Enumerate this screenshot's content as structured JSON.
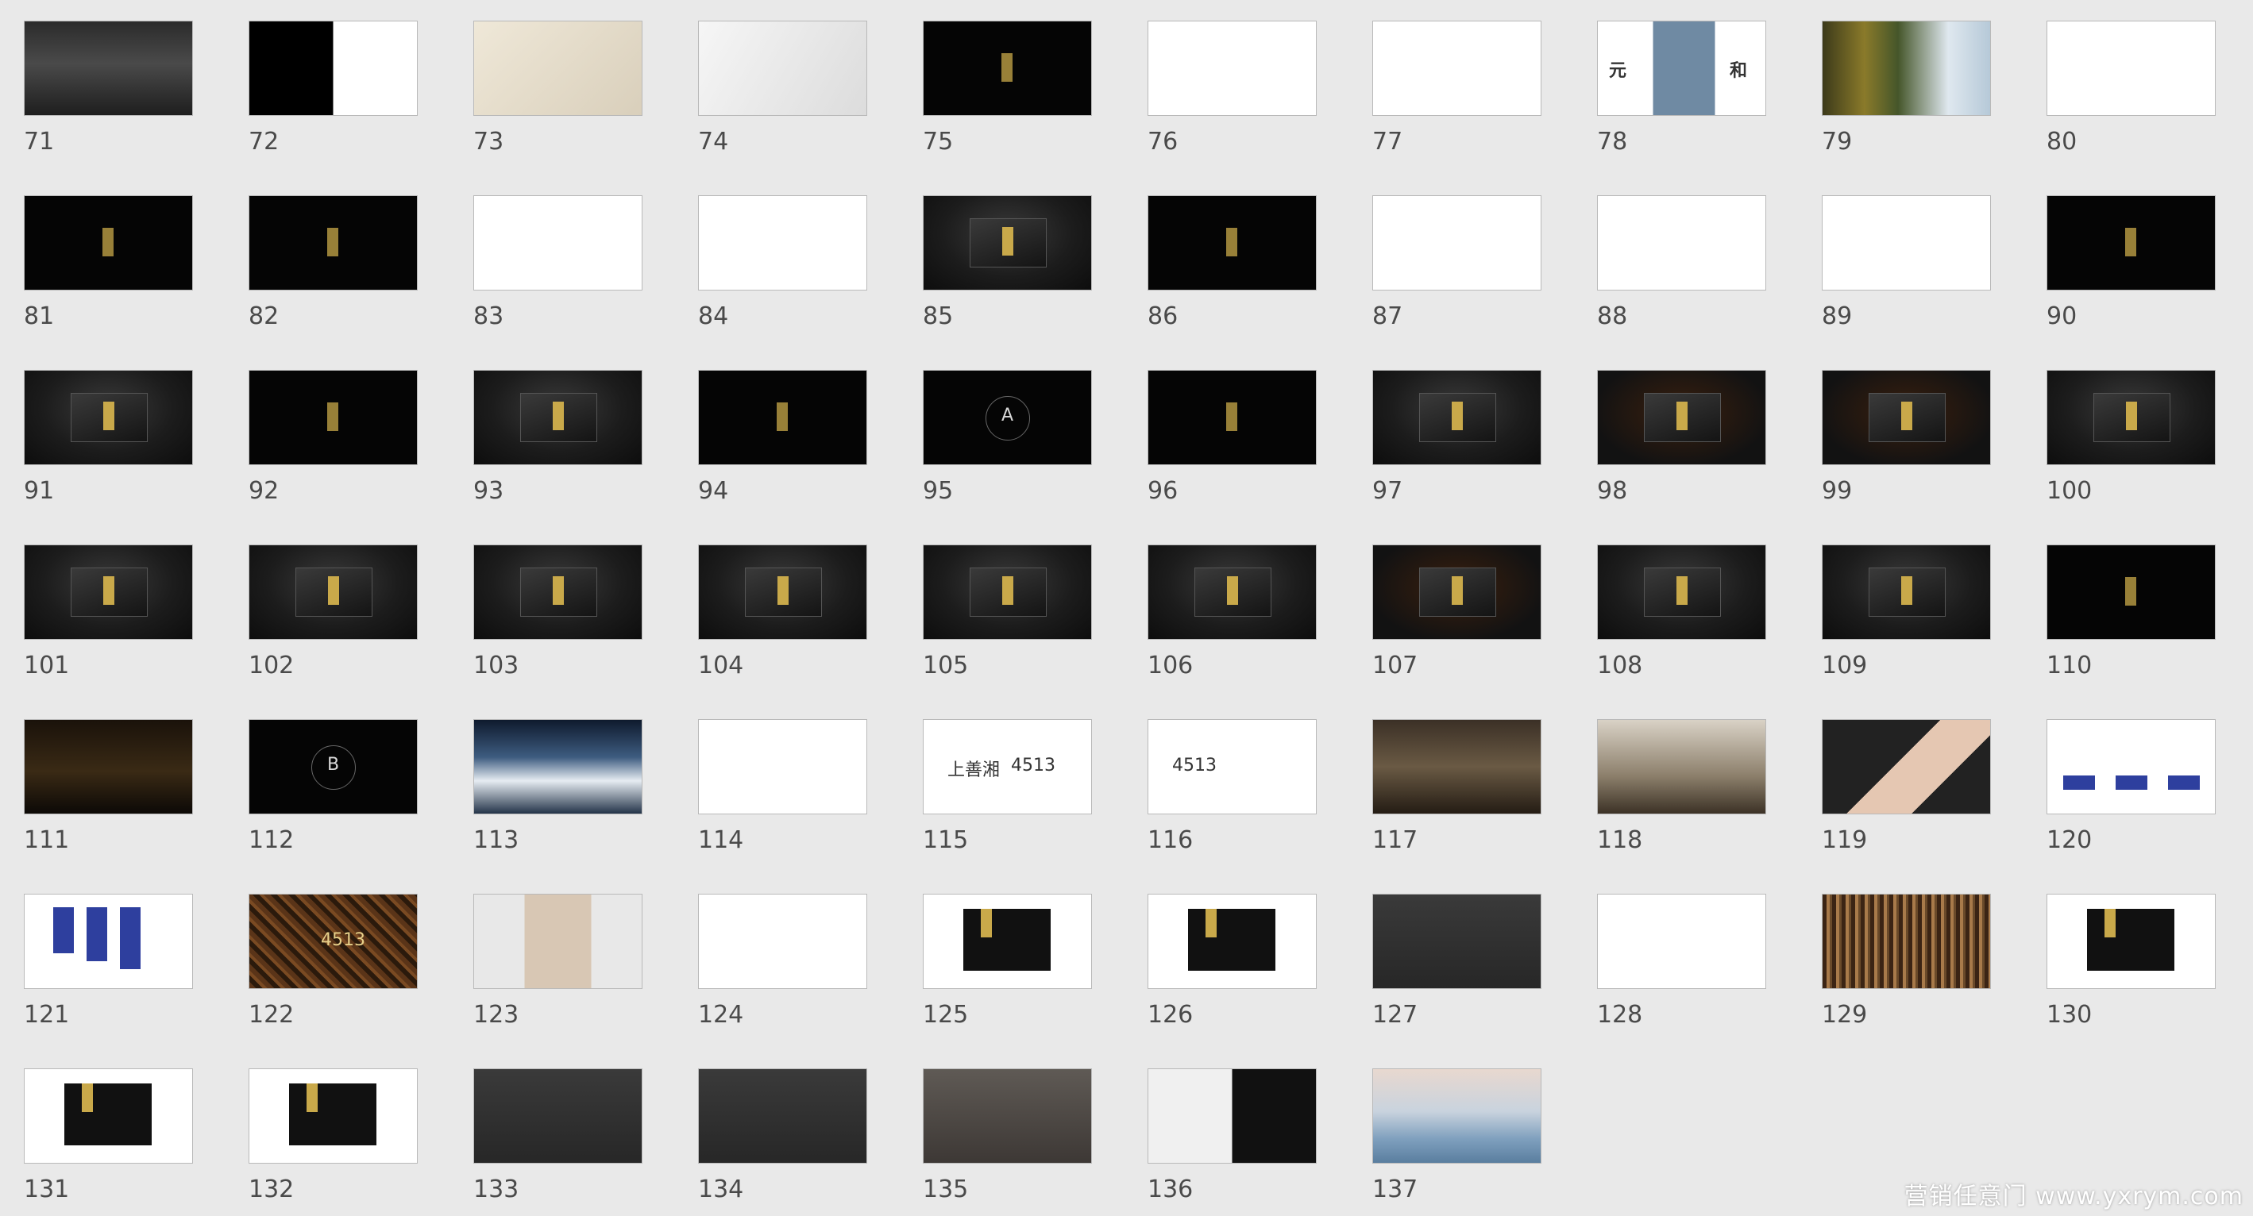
{
  "slides": [
    {
      "num": "71",
      "style": "t-mountain"
    },
    {
      "num": "72",
      "style": "t-split"
    },
    {
      "num": "73",
      "style": "t-paper"
    },
    {
      "num": "74",
      "style": "t-emboss"
    },
    {
      "num": "75",
      "style": "t-dark"
    },
    {
      "num": "76",
      "style": "t-white"
    },
    {
      "num": "77",
      "style": "t-white"
    },
    {
      "num": "78",
      "style": "t-sky",
      "text": [
        "元",
        "和"
      ]
    },
    {
      "num": "79",
      "style": "t-forest"
    },
    {
      "num": "80",
      "style": "t-white"
    },
    {
      "num": "81",
      "style": "t-dark"
    },
    {
      "num": "82",
      "style": "t-dark"
    },
    {
      "num": "83",
      "style": "t-white"
    },
    {
      "num": "84",
      "style": "t-white"
    },
    {
      "num": "85",
      "style": "t-darkgrad"
    },
    {
      "num": "86",
      "style": "t-dark"
    },
    {
      "num": "87",
      "style": "t-white"
    },
    {
      "num": "88",
      "style": "t-white"
    },
    {
      "num": "89",
      "style": "t-white"
    },
    {
      "num": "90",
      "style": "t-dark"
    },
    {
      "num": "91",
      "style": "t-darkgrad"
    },
    {
      "num": "92",
      "style": "t-dark"
    },
    {
      "num": "93",
      "style": "t-darkgrad"
    },
    {
      "num": "94",
      "style": "t-dark"
    },
    {
      "num": "95",
      "style": "t-dark",
      "text": [
        "A"
      ]
    },
    {
      "num": "96",
      "style": "t-dark"
    },
    {
      "num": "97",
      "style": "t-darkgrad"
    },
    {
      "num": "98",
      "style": "t-coffee"
    },
    {
      "num": "99",
      "style": "t-coffee"
    },
    {
      "num": "100",
      "style": "t-darkgrad"
    },
    {
      "num": "101",
      "style": "t-darkgrad"
    },
    {
      "num": "102",
      "style": "t-darkgrad"
    },
    {
      "num": "103",
      "style": "t-darkgrad"
    },
    {
      "num": "104",
      "style": "t-darkgrad"
    },
    {
      "num": "105",
      "style": "t-darkgrad"
    },
    {
      "num": "106",
      "style": "t-darkgrad"
    },
    {
      "num": "107",
      "style": "t-coffee"
    },
    {
      "num": "108",
      "style": "t-darkgrad"
    },
    {
      "num": "109",
      "style": "t-darkgrad"
    },
    {
      "num": "110",
      "style": "t-dark"
    },
    {
      "num": "111",
      "style": "t-store"
    },
    {
      "num": "112",
      "style": "t-dark",
      "text": [
        "B"
      ]
    },
    {
      "num": "113",
      "style": "t-snow"
    },
    {
      "num": "114",
      "style": "t-white"
    },
    {
      "num": "115",
      "style": "t-white",
      "text": [
        "上善湘",
        "4513"
      ]
    },
    {
      "num": "116",
      "style": "t-white",
      "text": [
        "4513"
      ]
    },
    {
      "num": "117",
      "style": "t-interior"
    },
    {
      "num": "118",
      "style": "t-gallery"
    },
    {
      "num": "119",
      "style": "t-hand"
    },
    {
      "num": "120",
      "style": "t-bluewhite"
    },
    {
      "num": "121",
      "style": "t-white"
    },
    {
      "num": "122",
      "style": "t-worms",
      "text": [
        "4513"
      ]
    },
    {
      "num": "123",
      "style": "t-person"
    },
    {
      "num": "124",
      "style": "t-white"
    },
    {
      "num": "125",
      "style": "t-white"
    },
    {
      "num": "126",
      "style": "t-white"
    },
    {
      "num": "127",
      "style": "t-gray"
    },
    {
      "num": "128",
      "style": "t-white"
    },
    {
      "num": "129",
      "style": "t-mat"
    },
    {
      "num": "130",
      "style": "t-white"
    },
    {
      "num": "131",
      "style": "t-white"
    },
    {
      "num": "132",
      "style": "t-white"
    },
    {
      "num": "133",
      "style": "t-gray"
    },
    {
      "num": "134",
      "style": "t-gray"
    },
    {
      "num": "135",
      "style": "t-bagbg"
    },
    {
      "num": "136",
      "style": "t-photos"
    },
    {
      "num": "137",
      "style": "t-haze"
    }
  ],
  "watermark": "营销任意门 www.yxrym.com",
  "colors": {
    "background": "#e9e9e9",
    "number_text": "#4a4a4a",
    "thumb_border": "#b9b9b9",
    "accent_gold": "#c9a94a",
    "accent_blue": "#2e3f9e"
  }
}
